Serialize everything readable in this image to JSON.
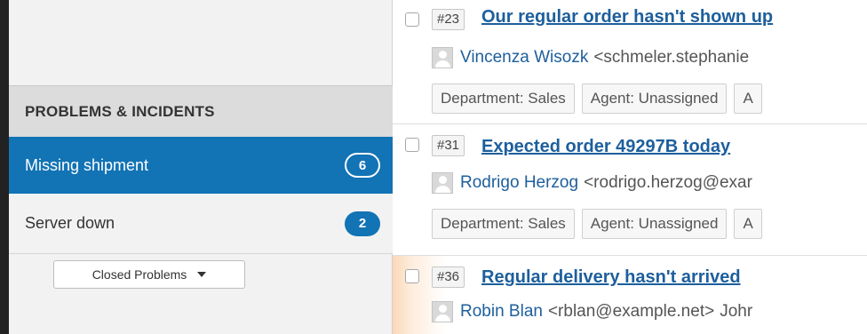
{
  "sidebar": {
    "section_title": "PROBLEMS & INCIDENTS",
    "items": [
      {
        "label": "Missing shipment",
        "count": "6",
        "active": true
      },
      {
        "label": "Server down",
        "count": "2",
        "active": false
      }
    ],
    "closed_dropdown": {
      "label": "Closed Problems"
    }
  },
  "tickets": [
    {
      "id": "#23",
      "subject": "Our regular order hasn't shown up",
      "requester_name": "Vincenza Wisozk",
      "requester_email": "<schmeler.stephanie",
      "requester_extra": "",
      "tags": [
        "Department: Sales",
        "Agent: Unassigned",
        "A"
      ]
    },
    {
      "id": "#31",
      "subject": "Expected order 49297B today",
      "requester_name": "Rodrigo Herzog",
      "requester_email": "<rodrigo.herzog@exar",
      "requester_extra": "",
      "tags": [
        "Department: Sales",
        "Agent: Unassigned",
        "A"
      ]
    },
    {
      "id": "#36",
      "subject": "Regular delivery hasn't arrived",
      "requester_name": "Robin Blan",
      "requester_email": "<rblan@example.net>",
      "requester_extra": "Johr",
      "tags": []
    }
  ],
  "colors": {
    "accent": "#1273b5",
    "link": "#1d5f9c",
    "highlight": "#fbd8b8"
  }
}
